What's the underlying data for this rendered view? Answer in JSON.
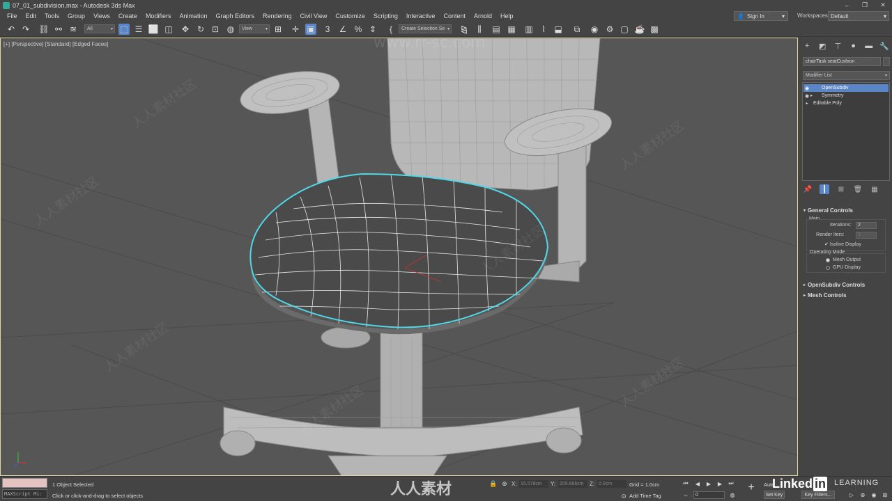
{
  "window": {
    "title": "07_01_subdivision.max - Autodesk 3ds Max",
    "minimize": "–",
    "maximize": "❐",
    "close": "✕"
  },
  "menu": {
    "items": [
      "File",
      "Edit",
      "Tools",
      "Group",
      "Views",
      "Create",
      "Modifiers",
      "Animation",
      "Graph Editors",
      "Rendering",
      "Civil View",
      "Customize",
      "Scripting",
      "Interactive",
      "Content",
      "Arnold",
      "Help"
    ],
    "sign_in": "Sign In",
    "workspaces_label": "Workspaces:",
    "workspace_value": "Default"
  },
  "toolbar": {
    "filter_value": "All",
    "ref_coord_value": "View",
    "selection_set_value": "Create Selection Se"
  },
  "viewport": {
    "label": "[+] [Perspective] [Standard] [Edged Faces]",
    "watermark_url": "www.rr-sc.com",
    "watermark_text": "人人素材社区"
  },
  "command_panel": {
    "object_name": "chairTask seatCushion",
    "modifier_list": "Modifier List",
    "stack": [
      {
        "label": "OpenSubdiv",
        "selected": true
      },
      {
        "label": "Symmetry",
        "selected": false
      },
      {
        "label": "Editable Poly",
        "selected": false
      }
    ],
    "general_controls": "General Controls",
    "main_label": "Main",
    "iterations_label": "Iterations:",
    "iterations_value": "2",
    "render_iters_label": "Render Iters:",
    "render_iters_value": "0",
    "isoline_label": "Isoline Display",
    "operating_mode_label": "Operating Mode",
    "mesh_output_label": "Mesh Output",
    "gpu_display_label": "GPU Display",
    "opensubdiv_controls": "OpenSubdiv Controls",
    "mesh_controls": "Mesh Controls"
  },
  "status": {
    "maxscript": "MAXScript Mi:",
    "selected_text": "1 Object Selected",
    "prompt_text": "Click or click-and-drag to select objects",
    "x_label": "X:",
    "x_value": "15.578cm",
    "y_label": "Y:",
    "y_value": "209.666cm",
    "z_label": "Z:",
    "z_value": "0.0cm",
    "grid_text": "Grid = 1.0cm",
    "add_time_tag": "Add Time Tag",
    "frame_value": "0",
    "auto_key": "Auto",
    "set_key": "Set Key",
    "key_filters": "Key Filters...",
    "brand_center": "人人素材",
    "linkedin": "Linked",
    "linkedin_in": "in",
    "learning": "LEARNING"
  },
  "colors": {
    "accent": "#5a86c8",
    "selection_outline": "#4fd8e8",
    "viewport_bg": "#565656",
    "maxscript_bg": "#e6c3c3"
  }
}
